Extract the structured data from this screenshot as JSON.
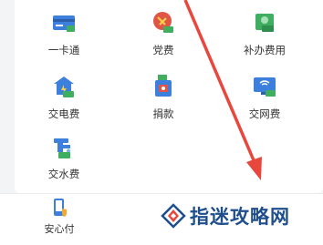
{
  "grid": {
    "items": [
      {
        "label": "一卡通",
        "icon": "card-icon"
      },
      {
        "label": "党费",
        "icon": "party-dues-icon"
      },
      {
        "label": "补办费用",
        "icon": "reissue-fee-icon"
      },
      {
        "label": "交电费",
        "icon": "electricity-fee-icon"
      },
      {
        "label": "捐款",
        "icon": "donation-icon"
      },
      {
        "label": "交网费",
        "icon": "internet-fee-icon"
      },
      {
        "label": "交水费",
        "icon": "water-fee-icon"
      }
    ]
  },
  "bottom_nav": {
    "tab_label": "安心付",
    "tab_icon": "phone-shield-icon"
  },
  "watermark": {
    "text": "指迷攻略网",
    "logo_icon": "zhimi-logo-icon"
  },
  "colors": {
    "icon_blue": "#3d7fdc",
    "icon_green": "#3fae60",
    "icon_red": "#e05545",
    "arrow_red": "#e8473d",
    "watermark_blue": "#1e4f8c"
  }
}
